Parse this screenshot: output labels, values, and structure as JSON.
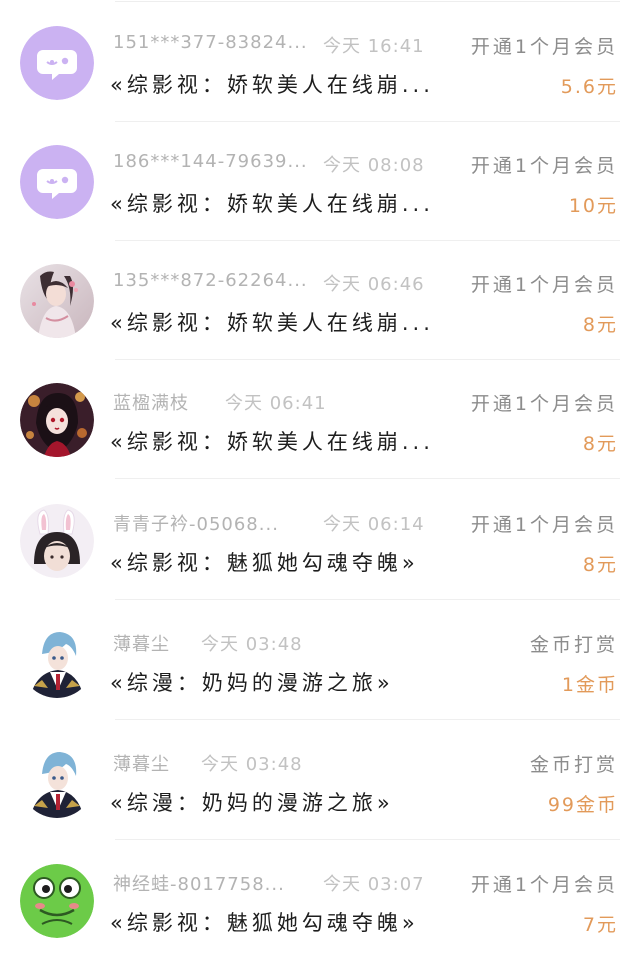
{
  "colors": {
    "accent_amount": "#e29a5a",
    "avatar_purple": "#cbb2f2",
    "avatar_frog": "#6ccb48"
  },
  "records": [
    {
      "avatar_icon": "chat-bubble-default-avatar-icon",
      "name": "151***377-83824...",
      "time": "今天 16:41",
      "action": "开通1个月会员",
      "book": "«综影视：娇软美人在线崩...",
      "amount": "5.6元"
    },
    {
      "avatar_icon": "chat-bubble-default-avatar-icon",
      "name": "186***144-79639...",
      "time": "今天 08:08",
      "action": "开通1个月会员",
      "book": "«综影视：娇软美人在线崩...",
      "amount": "10元"
    },
    {
      "avatar_icon": "anime-girl-white-dress-avatar",
      "name": "135***872-62264...",
      "time": "今天 06:46",
      "action": "开通1个月会员",
      "book": "«综影视：娇软美人在线崩...",
      "amount": "8元"
    },
    {
      "avatar_icon": "anime-girl-dark-hair-avatar",
      "name": "蓝楹满枝",
      "time": "今天 06:41",
      "action": "开通1个月会员",
      "book": "«综影视：娇软美人在线崩...",
      "amount": "8元"
    },
    {
      "avatar_icon": "girl-bunny-ears-avatar",
      "name": "青青子衿-05068...",
      "time": "今天 06:14",
      "action": "开通1个月会员",
      "book": "«综影视：魅狐她勾魂夺魄»",
      "amount": "8元"
    },
    {
      "avatar_icon": "anime-boy-blue-hair-avatar",
      "name": "薄暮尘",
      "time": "今天 03:48",
      "action": "金币打赏",
      "book": "«综漫：奶妈的漫游之旅»",
      "amount": "1金币"
    },
    {
      "avatar_icon": "anime-boy-blue-hair-avatar",
      "name": "薄暮尘",
      "time": "今天 03:48",
      "action": "金币打赏",
      "book": "«综漫：奶妈的漫游之旅»",
      "amount": "99金币"
    },
    {
      "avatar_icon": "green-frog-avatar",
      "name": "神经蛙-8017758...",
      "time": "今天 03:07",
      "action": "开通1个月会员",
      "book": "«综影视：魅狐她勾魂夺魄»",
      "amount": "7元"
    }
  ]
}
